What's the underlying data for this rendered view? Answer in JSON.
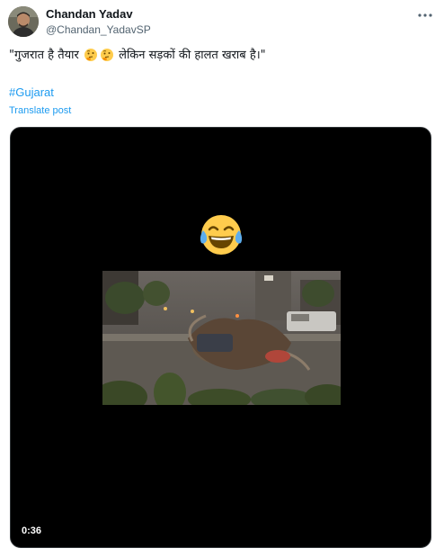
{
  "author": {
    "name": "Chandan Yadav",
    "handle": "@Chandan_YadavSP"
  },
  "tweet": {
    "text_part1": "\"गुजरात है तैयार",
    "text_part2": "लेकिन सड़कों की हालत खराब है।\"",
    "inline_emojis": [
      "thinking-face",
      "thinking-face"
    ],
    "hashtag": "#Gujarat",
    "translate_label": "Translate post"
  },
  "video": {
    "overlay_emoji": "face-with-tears-of-joy",
    "duration": "0:36"
  },
  "icons": {
    "more": "more-horizontal-icon"
  },
  "colors": {
    "link": "#1d9bf0",
    "secondary_text": "#536471",
    "primary_text": "#0f1419",
    "video_background": "#000000"
  }
}
